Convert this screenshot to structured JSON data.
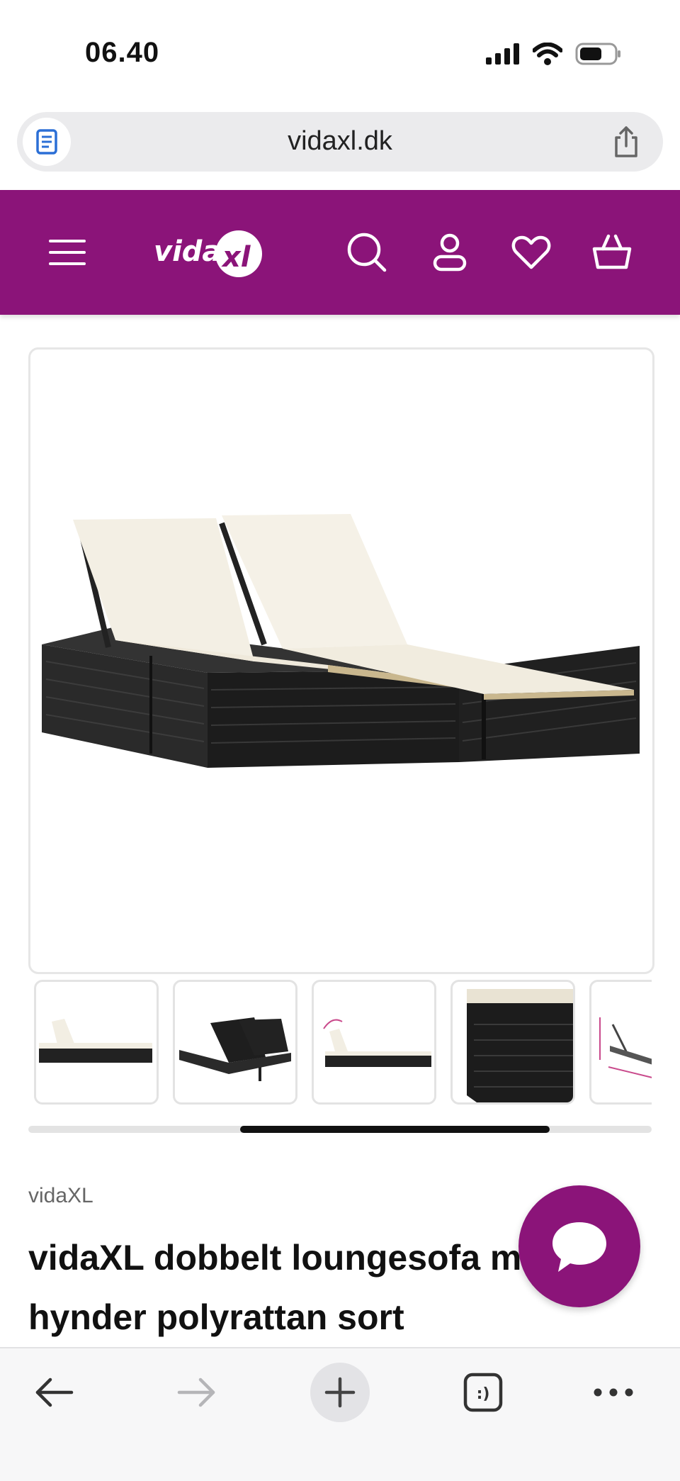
{
  "status_bar": {
    "time": "06.40",
    "icons": [
      "signal-icon",
      "wifi-icon",
      "battery-icon"
    ]
  },
  "browser": {
    "url": "vidaxl.dk",
    "tabs_label": ":)"
  },
  "site_header": {
    "logo": "vidaXL",
    "icons": [
      "menu-icon",
      "search-icon",
      "account-icon",
      "wishlist-heart-icon",
      "cart-basket-icon"
    ],
    "brand_color": "#8b1479"
  },
  "gallery": {
    "thumbnail_count": 5,
    "scroll_position": 0.34
  },
  "product": {
    "brand": "vidaXL",
    "title": "vidaXL dobbelt loungesofa med hynder polyrattan sort"
  },
  "bottom_toolbar": {
    "icons": [
      "back-arrow-icon",
      "forward-arrow-icon",
      "new-tab-plus-icon",
      "tabs-icon",
      "more-dots-icon"
    ]
  }
}
